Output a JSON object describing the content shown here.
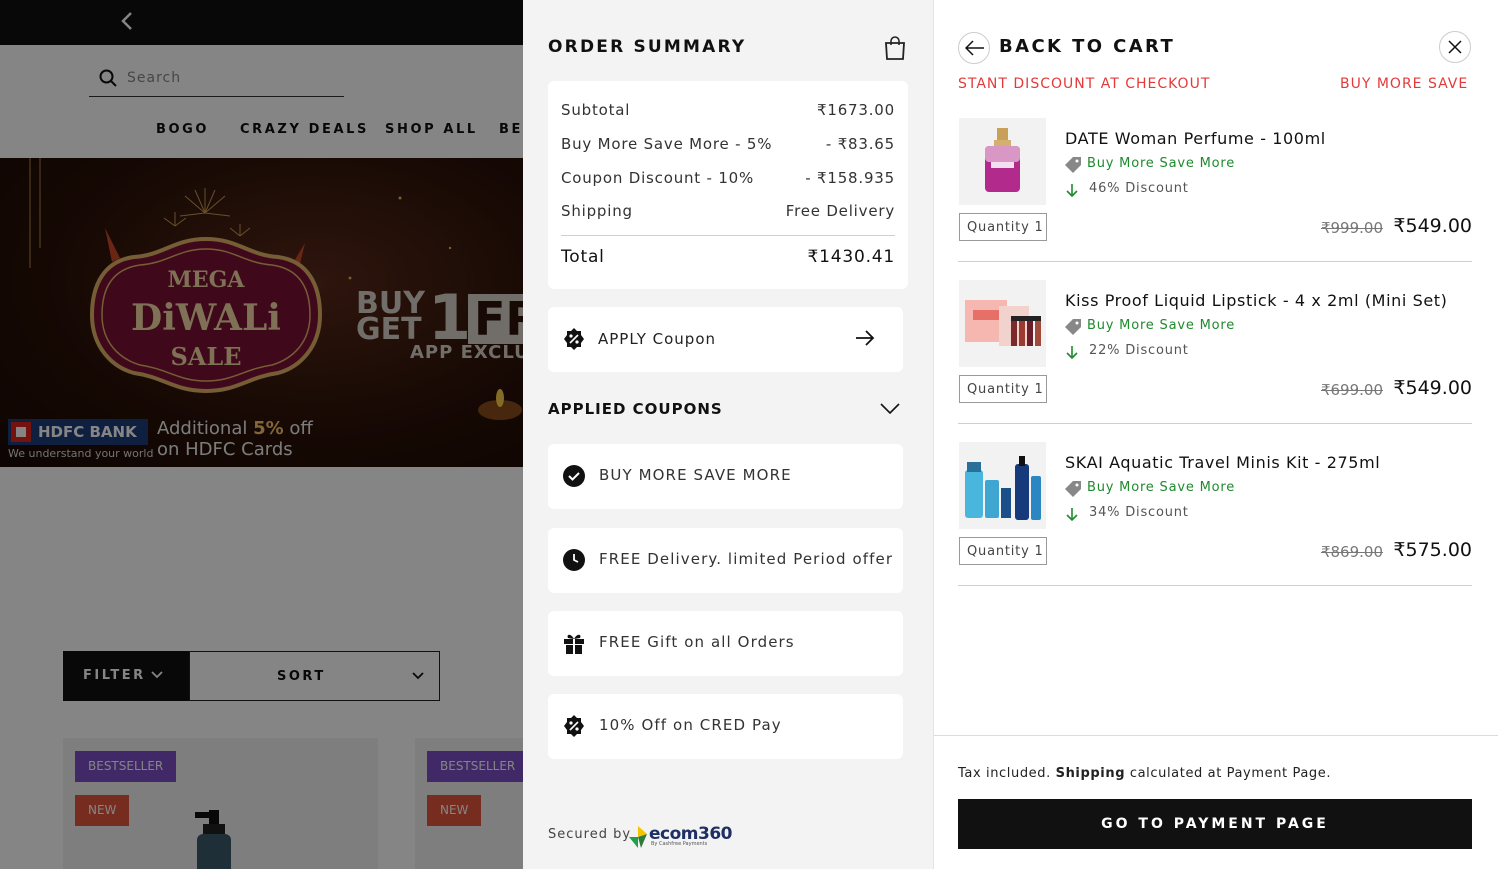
{
  "store": {
    "search_placeholder": "Search",
    "nav": [
      "BOGO",
      "CRAZY DEALS",
      "SHOP ALL",
      "BES"
    ],
    "banner": {
      "mega": "MEGA",
      "diwali": "DiWALi",
      "sale": "SALE",
      "buy": "BUY",
      "get": "GET",
      "one": "1",
      "free": "FR",
      "app": "APP EXCLU",
      "bank_name": "HDFC BANK",
      "bank_tagline": "We understand your world",
      "offer_prefix": "Additional ",
      "offer_bold": "5%",
      "offer_suffix": " off",
      "offer_line2": "on HDFC Cards"
    },
    "filter_label": "FILTER",
    "sort_label": "SORT",
    "cards": [
      {
        "badge1": "BESTSELLER",
        "badge2": "NEW"
      },
      {
        "badge1": "BESTSELLER",
        "badge2": "NEW"
      }
    ]
  },
  "summary": {
    "title": "ORDER SUMMARY",
    "rows": [
      {
        "label": "Subtotal",
        "value": "₹1673.00"
      },
      {
        "label": "Buy More Save More - 5%",
        "value": "- ₹83.65"
      },
      {
        "label": "Coupon Discount - 10%",
        "value": "- ₹158.935"
      },
      {
        "label": "Shipping",
        "value": "Free Delivery"
      }
    ],
    "total": {
      "label": "Total",
      "value": "₹1430.41"
    },
    "apply_coupon": "APPLY Coupon",
    "applied_heading": "APPLIED COUPONS",
    "coupons": [
      {
        "label": "BUY MORE SAVE MORE",
        "icon": "check-circle-icon"
      },
      {
        "label": "FREE Delivery. limited Period offer",
        "icon": "clock-icon"
      },
      {
        "label": "FREE Gift on all Orders",
        "icon": "gift-icon"
      },
      {
        "label": "10% Off on CRED Pay",
        "icon": "percent-badge-icon"
      }
    ],
    "secured_by": "Secured by",
    "ecom_logo": "ecom360",
    "ecom_sub": "By Cashfree Payments"
  },
  "cart": {
    "title": "BACK TO CART",
    "ticker": [
      "STANT DISCOUNT AT CHECKOUT",
      "BUY MORE SAVE M"
    ],
    "items": [
      {
        "name": "DATE Woman Perfume - 100ml",
        "deal": "Buy More Save More",
        "discount": "46% Discount",
        "qty": "Quantity 1",
        "old_price": "₹999.00",
        "price": "₹549.00"
      },
      {
        "name": "Kiss Proof Liquid Lipstick - 4 x 2ml (Mini Set)",
        "deal": "Buy More Save More",
        "discount": "22% Discount",
        "qty": "Quantity 1",
        "old_price": "₹699.00",
        "price": "₹549.00"
      },
      {
        "name": "SKAI Aquatic Travel Minis Kit - 275ml",
        "deal": "Buy More Save More",
        "discount": "34% Discount",
        "qty": "Quantity 1",
        "old_price": "₹869.00",
        "price": "₹575.00"
      }
    ],
    "tax_prefix": "Tax included. ",
    "tax_bold": "Shipping",
    "tax_suffix": " calculated at Payment Page.",
    "pay_button": "GO TO PAYMENT PAGE"
  },
  "colors": {
    "accent_red": "#e43a3a",
    "deal_green": "#1f8a2e",
    "badge_purple": "#7b4fc4",
    "badge_orange": "#e2573c"
  }
}
